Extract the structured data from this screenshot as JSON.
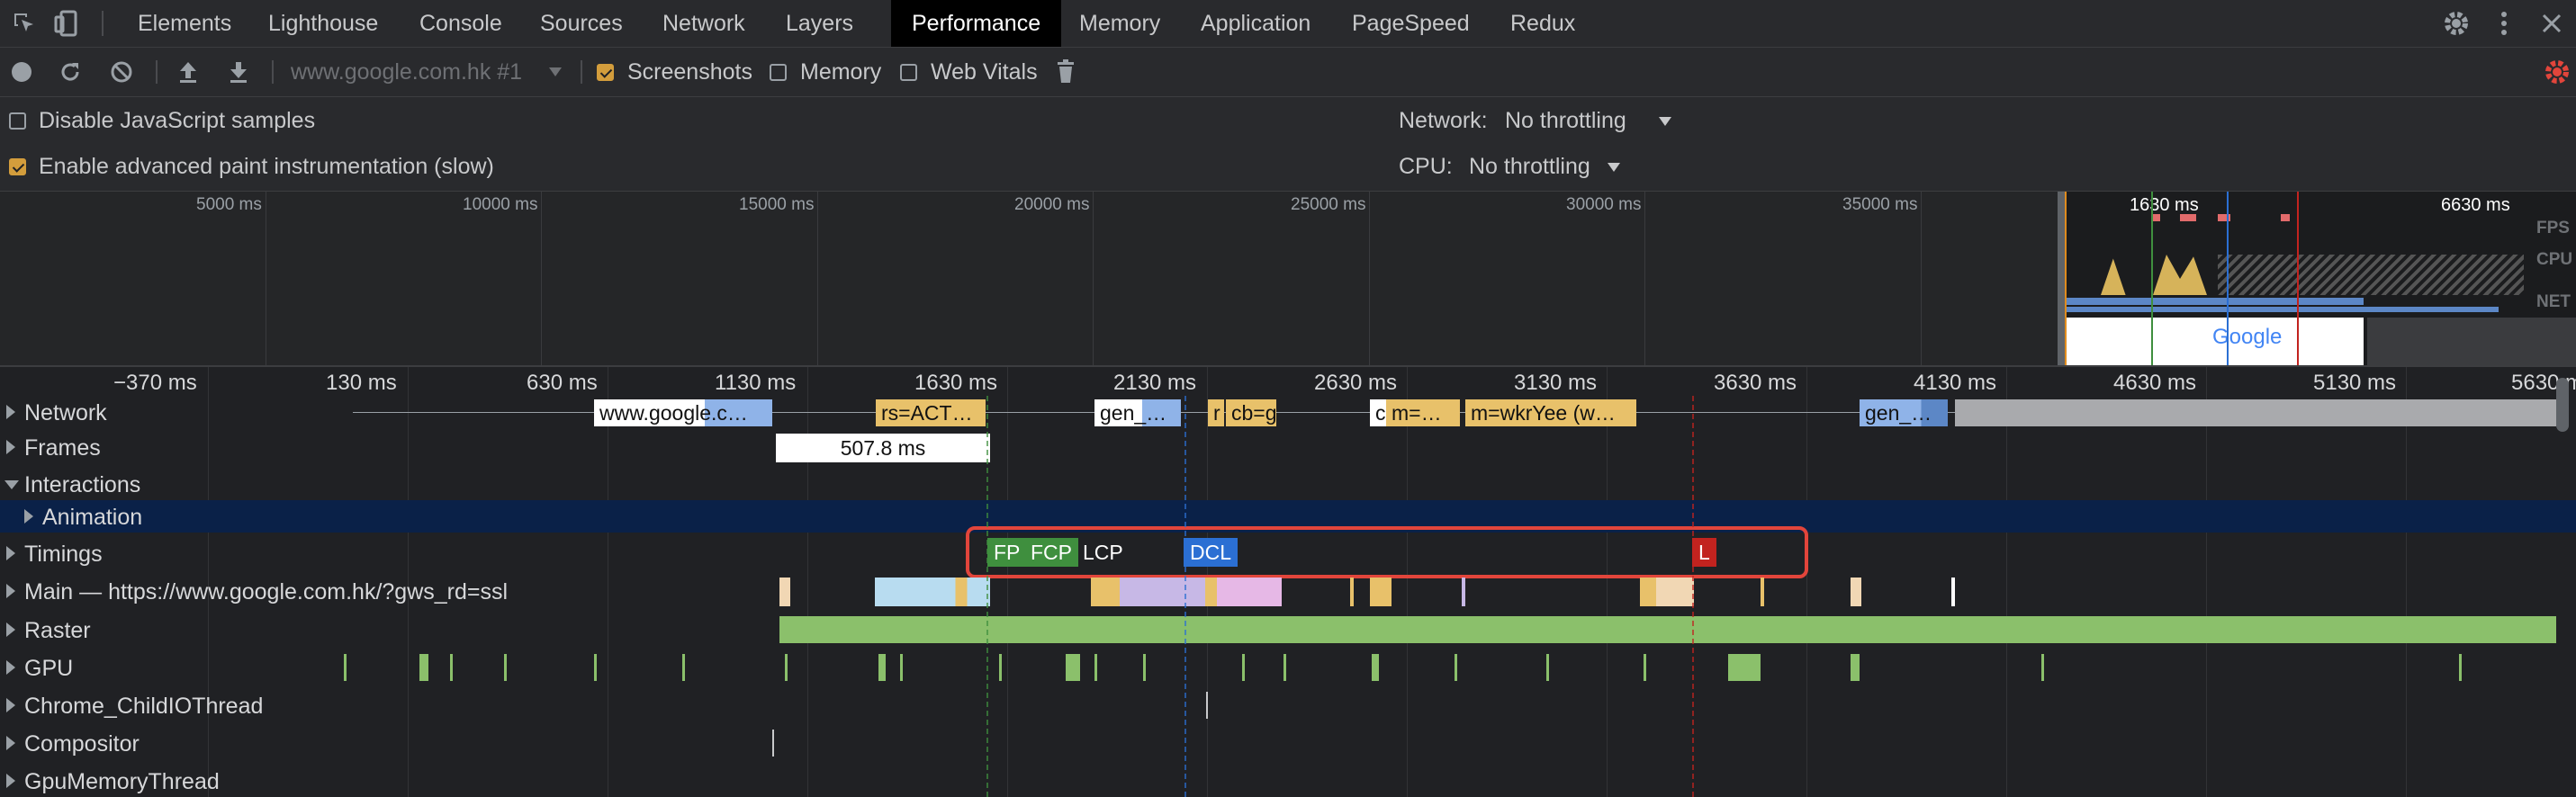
{
  "tabs": {
    "elements": "Elements",
    "lighthouse": "Lighthouse",
    "console": "Console",
    "sources": "Sources",
    "network": "Network",
    "layers": "Layers",
    "performance": "Performance",
    "memory": "Memory",
    "application": "Application",
    "pagespeed": "PageSpeed",
    "redux": "Redux"
  },
  "toolbar": {
    "recording_select": "www.google.com.hk #1",
    "screenshots_label": "Screenshots",
    "screenshots_checked": true,
    "memory_label": "Memory",
    "memory_checked": false,
    "webvitals_label": "Web Vitals",
    "webvitals_checked": false
  },
  "settings": {
    "disable_js_label": "Disable JavaScript samples",
    "disable_js_checked": false,
    "advanced_paint_label": "Enable advanced paint instrumentation (slow)",
    "advanced_paint_checked": true,
    "network_label": "Network:",
    "network_value": "No throttling",
    "cpu_label": "CPU:",
    "cpu_value": "No throttling"
  },
  "overview": {
    "ticks": [
      "5000 ms",
      "10000 ms",
      "15000 ms",
      "20000 ms",
      "25000 ms",
      "30000 ms",
      "35000 ms"
    ],
    "mini_left_label": "1630 ms",
    "mini_right_label": "6630 ms",
    "fps_label": "FPS",
    "cpu_label": "CPU",
    "net_label": "NET",
    "screenshot_logo": "Google"
  },
  "ruler": [
    "−370 ms",
    "130 ms",
    "630 ms",
    "1130 ms",
    "1630 ms",
    "2130 ms",
    "2630 ms",
    "3130 ms",
    "3630 ms",
    "4130 ms",
    "4630 ms",
    "5130 ms",
    "5630 ms"
  ],
  "tracks": {
    "network": "Network",
    "frames": "Frames",
    "interactions": "Interactions",
    "animation": "Animation",
    "timings": "Timings",
    "main": "Main — https://www.google.com.hk/?gws_rd=ssl",
    "raster": "Raster",
    "gpu": "GPU",
    "child_io": "Chrome_ChildIOThread",
    "compositor": "Compositor",
    "gpu_memory": "GpuMemoryThread"
  },
  "network_requests": [
    "www.google.c…",
    "rs=ACT…",
    "gen_…",
    "r",
    "cb=g",
    "c",
    "m=…",
    "m=wkrYee (w…",
    "gen_…"
  ],
  "frame_duration": "507.8 ms",
  "timings": {
    "fp": "FP",
    "fcp": "FCP",
    "lcp": "LCP",
    "dcl": "DCL",
    "l": "L"
  },
  "colors": {
    "highlight_box": "#e2453b",
    "fp": "#3f8f3e",
    "fcp": "#3f8f3e",
    "dcl": "#2b6fd3",
    "l": "#c2231f",
    "raster": "#8bc06b",
    "animation_row": "#0a2148"
  }
}
